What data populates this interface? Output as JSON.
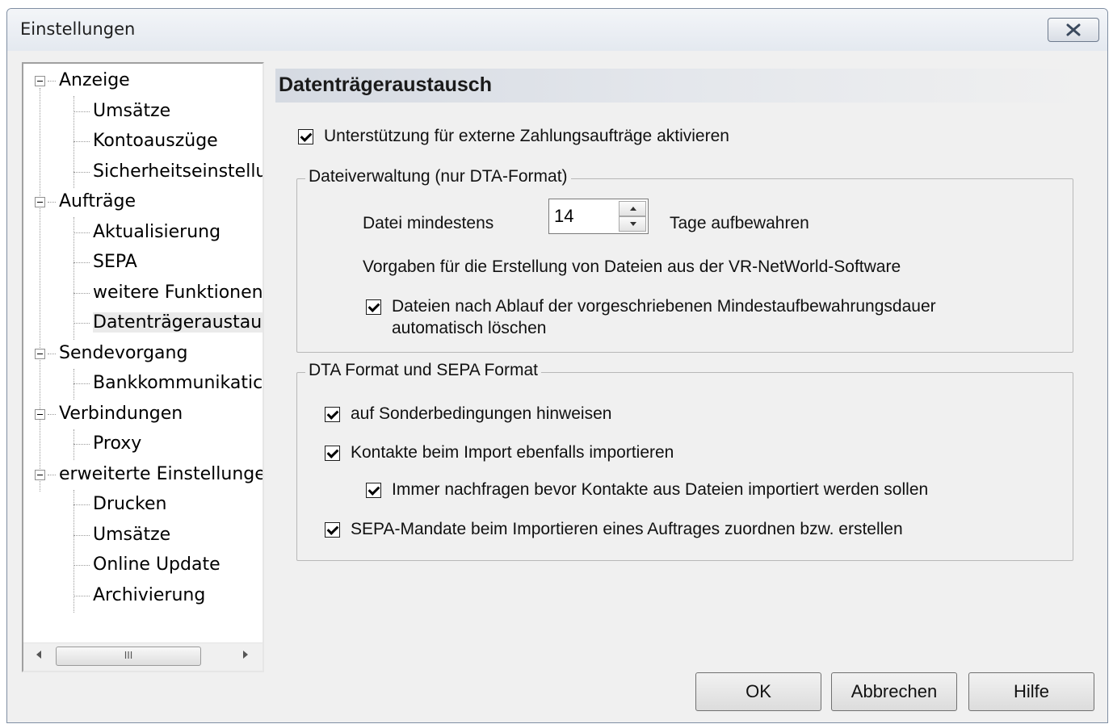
{
  "window": {
    "title": "Einstellungen"
  },
  "tree": {
    "items": [
      {
        "label": "Anzeige",
        "level": 0
      },
      {
        "label": "Umsätze",
        "level": 1
      },
      {
        "label": "Kontoauszüge",
        "level": 1
      },
      {
        "label": "Sicherheitseinstellu",
        "level": 1
      },
      {
        "label": "Aufträge",
        "level": 0
      },
      {
        "label": "Aktualisierung",
        "level": 1
      },
      {
        "label": "SEPA",
        "level": 1
      },
      {
        "label": "weitere Funktionen",
        "level": 1
      },
      {
        "label": "Datenträgeraustaus",
        "level": 1,
        "selected": true
      },
      {
        "label": "Sendevorgang",
        "level": 0
      },
      {
        "label": "Bankkommunikatic",
        "level": 1
      },
      {
        "label": "Verbindungen",
        "level": 0
      },
      {
        "label": "Proxy",
        "level": 1
      },
      {
        "label": "erweiterte Einstellunge",
        "level": 0
      },
      {
        "label": "Drucken",
        "level": 1
      },
      {
        "label": "Umsätze",
        "level": 1
      },
      {
        "label": "Online Update",
        "level": 1
      },
      {
        "label": "Archivierung",
        "level": 1
      }
    ],
    "scroll_thumb_label": "III"
  },
  "panel": {
    "title": "Datenträgeraustausch",
    "enable_checkbox": {
      "label": "Unterstützung für externe Zahlungsaufträge aktivieren",
      "checked": true
    },
    "file_group": {
      "legend": "Dateiverwaltung (nur DTA-Format)",
      "min_label": "Datei mindestens",
      "days_value": "14",
      "days_suffix": "Tage aufbewahren",
      "defaults_text": "Vorgaben für die Erstellung von Dateien aus der VR-NetWorld-Software",
      "delete_checkbox": {
        "line1": "Dateien nach Ablauf der vorgeschriebenen Mindestaufbewahrungsdauer",
        "line2": "automatisch löschen",
        "checked": true
      }
    },
    "format_group": {
      "legend": "DTA Format und SEPA Format",
      "special_checkbox": {
        "label": "auf Sonderbedingungen hinweisen",
        "checked": true
      },
      "contacts_checkbox": {
        "label": "Kontakte beim Import ebenfalls importieren",
        "checked": true
      },
      "ask_checkbox": {
        "label": "Immer nachfragen bevor Kontakte aus Dateien importiert werden sollen",
        "checked": true
      },
      "mandate_checkbox": {
        "label": "SEPA-Mandate beim Importieren eines Auftrages zuordnen bzw. erstellen",
        "checked": true
      }
    }
  },
  "buttons": {
    "ok": "OK",
    "cancel": "Abbrechen",
    "help": "Hilfe"
  },
  "icons": {
    "close": "close-icon",
    "expander": "collapse-icon"
  },
  "colors": {
    "header_gradient_start": "#d5dae2",
    "client_bg": "#f0f0f0",
    "titlebar": "#e4e9f0"
  }
}
